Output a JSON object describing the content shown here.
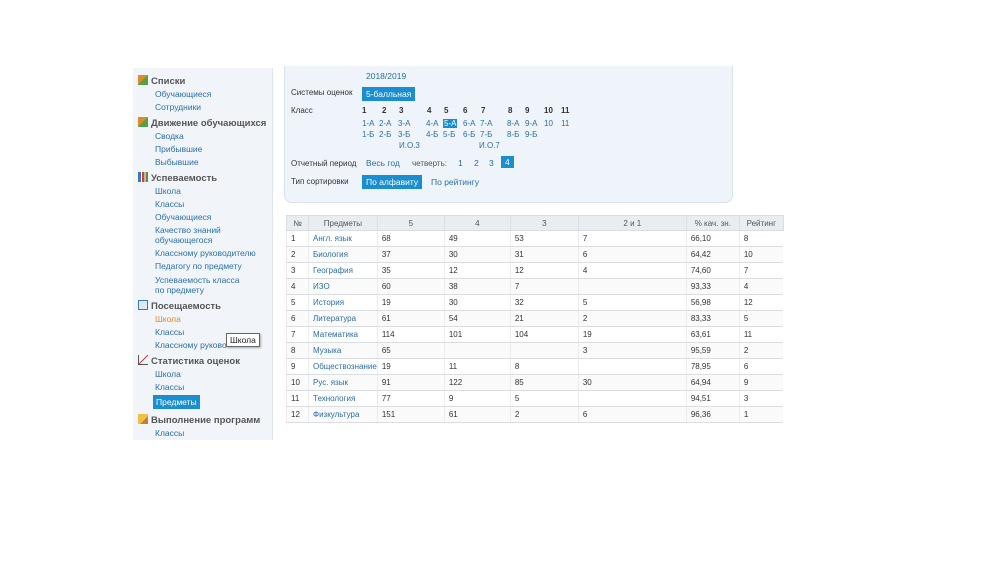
{
  "sidebar": {
    "sections": [
      {
        "title": "Списки",
        "icon": "lists-icon",
        "items": [
          "Обучающиеся",
          "Сотрудники"
        ]
      },
      {
        "title": "Движение обучающихся",
        "icon": "movement-icon",
        "items": [
          "Сводка",
          "Прибывшие",
          "Выбывшие"
        ]
      },
      {
        "title": "Успеваемость",
        "icon": "bar-chart-icon",
        "items": [
          "Школа",
          "Классы",
          "Обучающиеся",
          "Качество знаний",
          "обучающегося",
          "Классному руководителю",
          "Педагогу по предмету",
          "Успеваемость класса",
          "по предмету"
        ]
      },
      {
        "title": "Посещаемость",
        "icon": "calendar-icon",
        "items": [
          "Школа",
          "Классы",
          "Классному руково"
        ]
      },
      {
        "title": "Статистика оценок",
        "icon": "line-chart-icon",
        "items": [
          "Школа",
          "Классы",
          "Предметы"
        ]
      },
      {
        "title": "Выполнение программ",
        "icon": "edit-icon",
        "items": [
          "Классы"
        ]
      }
    ]
  },
  "tooltip": "Школа",
  "filter": {
    "year": "2018/2019",
    "grading_label": "Системы оценок",
    "grading_value": "5-балльная",
    "class_label": "Класс",
    "grades": [
      "1",
      "2",
      "3",
      "4",
      "5",
      "6",
      "7",
      "8",
      "9",
      "10",
      "11"
    ],
    "classes_row1": [
      "1-А",
      "2-А",
      "3-А",
      "4-А",
      "5-А",
      "6-А",
      "7-А",
      "8-А",
      "9-А",
      "10",
      "11"
    ],
    "classes_row2": [
      "1-Б",
      "2-Б",
      "3-Б",
      "4-Б",
      "5-Б",
      "6-Б",
      "7-Б",
      "8-Б",
      "9-Б"
    ],
    "classes_row3": [
      "И.О.3",
      "И.О.7"
    ],
    "period_label": "Отчетный период",
    "period_year": "Весь год",
    "quarter_label": "четверть:",
    "quarters": [
      "1",
      "2",
      "3",
      "4"
    ],
    "sort_label": "Тип сортировки",
    "sort_alpha": "По алфавиту",
    "sort_rating": "По рейтингу"
  },
  "table": {
    "headers": [
      "№",
      "Предметы",
      "5",
      "4",
      "3",
      "2 и 1",
      "% кач. зн.",
      "Рейтинг"
    ],
    "rows": [
      [
        "1",
        "Англ. язык",
        "68",
        "49",
        "53",
        "7",
        "66,10",
        "8"
      ],
      [
        "2",
        "Биология",
        "37",
        "30",
        "31",
        "6",
        "64,42",
        "10"
      ],
      [
        "3",
        "География",
        "35",
        "12",
        "12",
        "4",
        "74,60",
        "7"
      ],
      [
        "4",
        "ИЗО",
        "60",
        "38",
        "7",
        "",
        "93,33",
        "4"
      ],
      [
        "5",
        "История",
        "19",
        "30",
        "32",
        "5",
        "56,98",
        "12"
      ],
      [
        "6",
        "Литература",
        "61",
        "54",
        "21",
        "2",
        "83,33",
        "5"
      ],
      [
        "7",
        "Математика",
        "114",
        "101",
        "104",
        "19",
        "63,61",
        "11"
      ],
      [
        "8",
        "Музыка",
        "65",
        "",
        "",
        "3",
        "95,59",
        "2"
      ],
      [
        "9",
        "Обществознание",
        "19",
        "11",
        "8",
        "",
        "78,95",
        "6"
      ],
      [
        "10",
        "Рус. язык",
        "91",
        "122",
        "85",
        "30",
        "64,94",
        "9"
      ],
      [
        "11",
        "Технология",
        "77",
        "9",
        "5",
        "",
        "94,51",
        "3"
      ],
      [
        "12",
        "Физкультура",
        "151",
        "61",
        "2",
        "6",
        "96,36",
        "1"
      ]
    ]
  }
}
